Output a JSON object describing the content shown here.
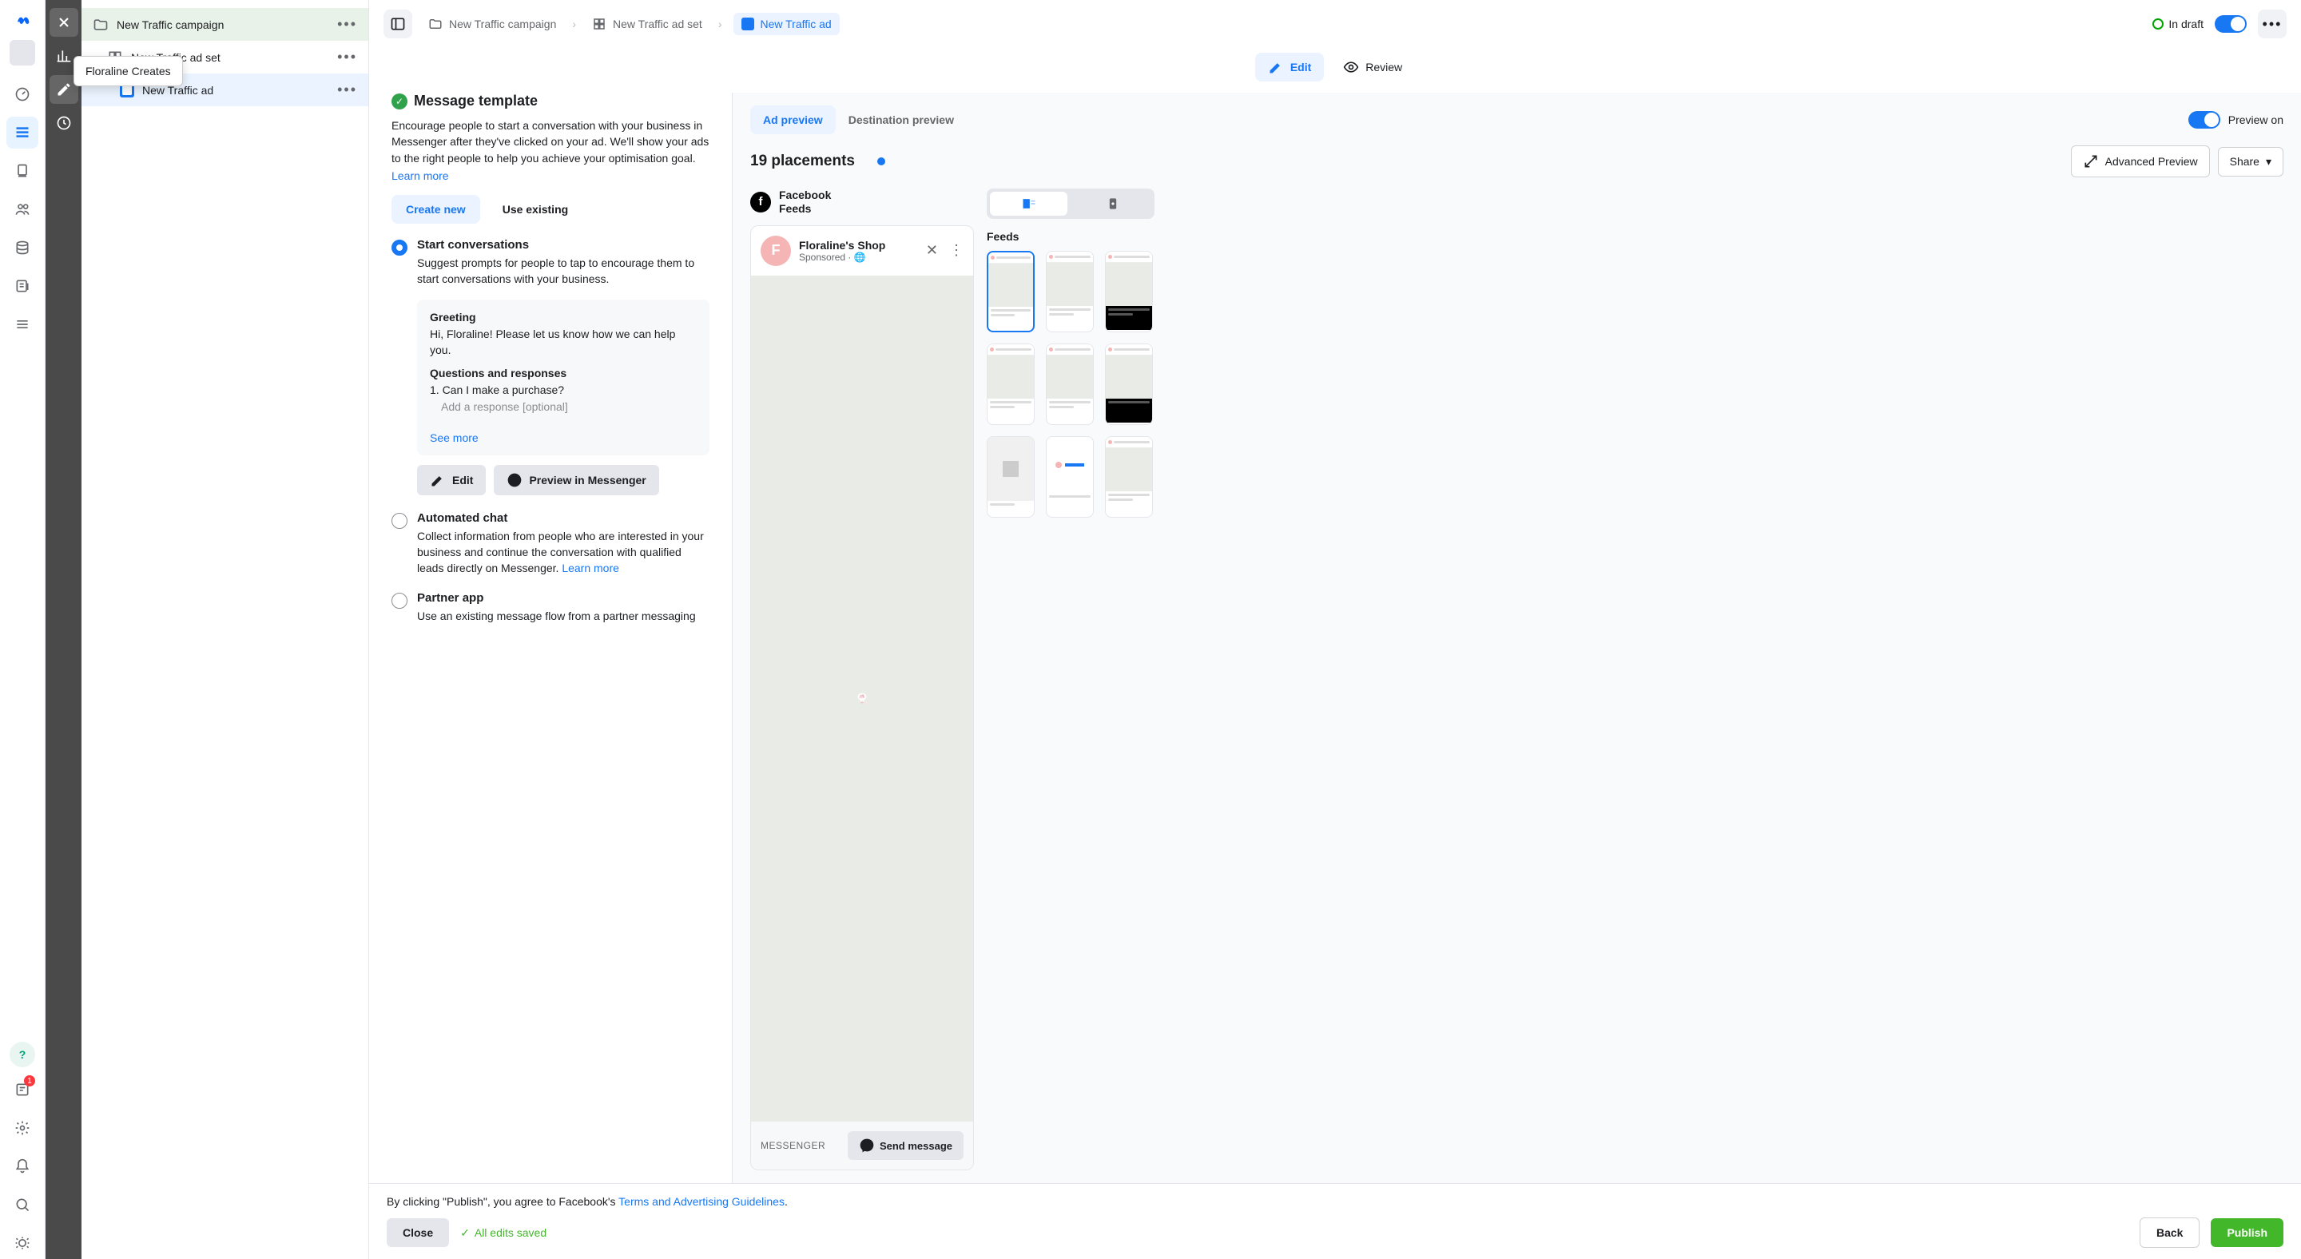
{
  "tooltip": "Floraline Creates",
  "tree": {
    "campaign": "New Traffic campaign",
    "adset": "New Traffic ad set",
    "ad": "New Traffic ad"
  },
  "breadcrumbs": {
    "campaign": "New Traffic campaign",
    "adset": "New Traffic ad set",
    "ad": "New Traffic ad"
  },
  "status": "In draft",
  "tabs": {
    "edit": "Edit",
    "review": "Review"
  },
  "section": {
    "title": "Message template",
    "desc": "Encourage people to start a conversation with your business in Messenger after they've clicked on your ad. We'll show your ads to the right people to help you achieve your optimisation goal.",
    "learn": "Learn more",
    "createNew": "Create new",
    "useExisting": "Use existing"
  },
  "options": {
    "start": {
      "title": "Start conversations",
      "desc": "Suggest prompts for people to tap to encourage them to start conversations with your business."
    },
    "auto": {
      "title": "Automated chat",
      "desc": "Collect information from people who are interested in your business and continue the conversation with qualified leads directly on Messenger. ",
      "learn": "Learn more"
    },
    "partner": {
      "title": "Partner app",
      "desc": "Use an existing message flow from a partner messaging"
    }
  },
  "card": {
    "greeting": "Greeting",
    "greetingText": "Hi, Floraline! Please let us know how we can help you.",
    "qr": "Questions and responses",
    "q1": "1. Can I make a purchase?",
    "addResp": "Add a response [optional]",
    "seeMore": "See more"
  },
  "buttons": {
    "edit": "Edit",
    "preview": "Preview in Messenger"
  },
  "preview": {
    "tabAd": "Ad preview",
    "tabDest": "Destination preview",
    "toggleLabel": "Preview on",
    "placements": "19 placements",
    "advanced": "Advanced Preview",
    "share": "Share",
    "platform": "Facebook",
    "platformSub": "Feeds",
    "adName": "Floraline's Shop",
    "adSub": "Sponsored · 🌐",
    "footLabel": "MESSENGER",
    "sendBtn": "Send message",
    "feedsH": "Feeds"
  },
  "footer": {
    "textPrefix": "By clicking \"Publish\", you agree to Facebook's ",
    "link": "Terms and Advertising Guidelines",
    "close": "Close",
    "saved": "All edits saved",
    "back": "Back",
    "publish": "Publish"
  }
}
